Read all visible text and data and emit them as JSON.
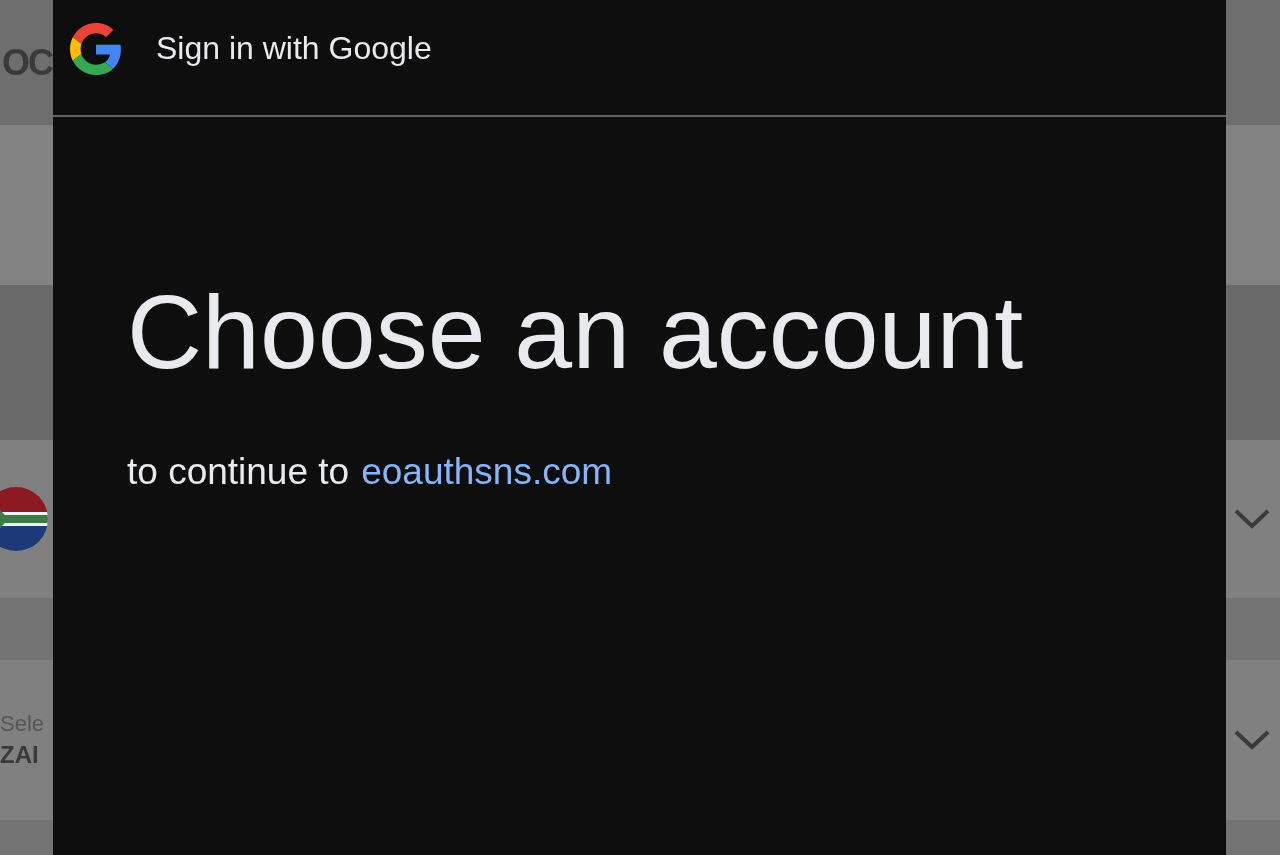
{
  "background_page": {
    "header_text": "OC",
    "currency_select": {
      "label": "Sele",
      "value": "ZAI"
    }
  },
  "dialog": {
    "title": "Sign in with Google",
    "heading": "Choose an account",
    "subtitle": "to continue to",
    "site_link": "eoauthsns.com"
  }
}
